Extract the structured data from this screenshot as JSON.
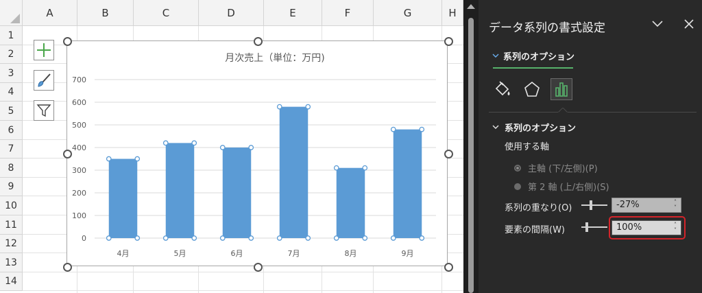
{
  "sheet": {
    "columns": [
      "A",
      "B",
      "C",
      "D",
      "E",
      "F",
      "G",
      "H"
    ],
    "rows": [
      "1",
      "2",
      "3",
      "4",
      "5",
      "6",
      "7",
      "8",
      "9",
      "10",
      "11",
      "12",
      "13",
      "14"
    ]
  },
  "chart_data": {
    "type": "bar",
    "title": "月次売上（単位：万円)",
    "categories": [
      "4月",
      "5月",
      "6月",
      "7月",
      "8月",
      "9月"
    ],
    "values": [
      350,
      420,
      400,
      580,
      310,
      480
    ],
    "ylim": [
      0,
      700
    ],
    "yticks": [
      0,
      100,
      200,
      300,
      400,
      500,
      600,
      700
    ],
    "grid": true,
    "bar_color": "#5b9bd5",
    "selected": true
  },
  "pane": {
    "title": "データ系列の書式設定",
    "tab_label": "系列のオプション",
    "section_label": "系列のオプション",
    "axis_label": "使用する軸",
    "primary_axis": "主軸 (下/左側)(P)",
    "secondary_axis": "第 2 軸 (上/右側)(S)",
    "overlap_label": "系列の重なり(O)",
    "overlap_value": "-27%",
    "gap_label": "要素の間隔(W)",
    "gap_value": "100%",
    "accent_color": "#57b26b",
    "highlight_color": "#d4242a"
  },
  "icons": {
    "chart_elements": "plus-icon",
    "chart_styles": "brush-icon",
    "chart_filters": "funnel-icon",
    "fill_line": "paint-bucket-icon",
    "effects": "pentagon-icon",
    "series_options": "bar-chart-icon",
    "collapse": "chevron-down-icon",
    "close": "close-icon"
  }
}
